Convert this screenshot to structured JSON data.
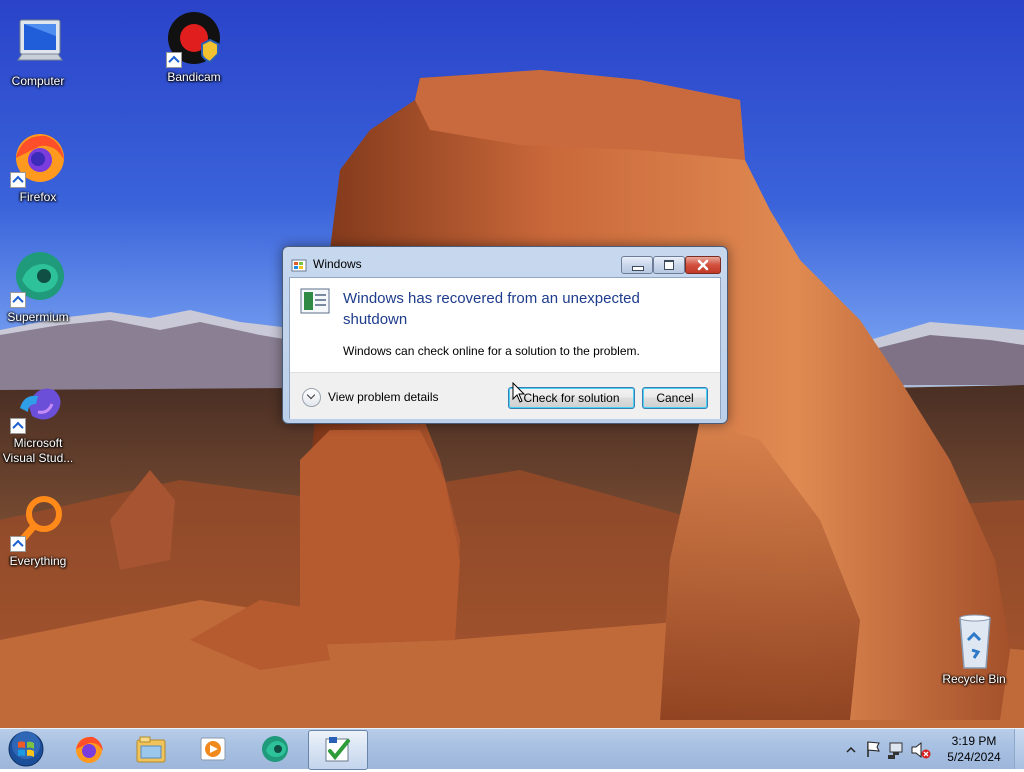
{
  "desktop": {
    "icons": [
      {
        "label": "Computer"
      },
      {
        "label": "Bandicam"
      },
      {
        "label": "Firefox"
      },
      {
        "label": "Supermium"
      },
      {
        "label": "Microsoft Visual Stud..."
      },
      {
        "label": "Everything"
      },
      {
        "label": "Recycle Bin"
      }
    ]
  },
  "dialog": {
    "title": "Windows",
    "heading": "Windows has recovered from an unexpected shutdown",
    "message": "Windows can check online for a solution to the problem.",
    "details_label": "View problem details",
    "check_button": "Check for solution",
    "cancel_button": "Cancel"
  },
  "taskbar": {
    "items": [
      "start-orb",
      "firefox-icon",
      "file-explorer-icon",
      "media-player-icon",
      "supermium-icon",
      "problem-reports-icon"
    ],
    "clock": {
      "time": "3:19 PM",
      "date": "5/24/2024"
    }
  },
  "colors": {
    "heading": "#1e3c8c",
    "taskbar": "#a9c1e2",
    "dialog_frame": "#bcd0ea"
  }
}
